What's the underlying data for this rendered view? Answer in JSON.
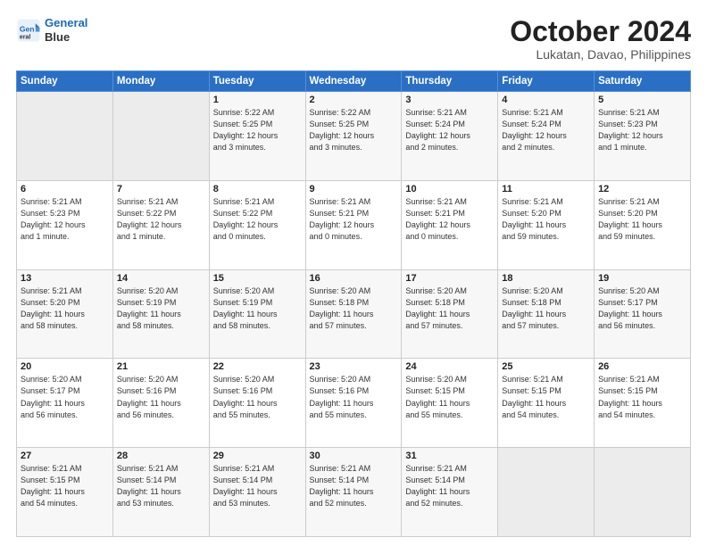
{
  "header": {
    "logo_line1": "General",
    "logo_line2": "Blue",
    "month_title": "October 2024",
    "location": "Lukatan, Davao, Philippines"
  },
  "weekdays": [
    "Sunday",
    "Monday",
    "Tuesday",
    "Wednesday",
    "Thursday",
    "Friday",
    "Saturday"
  ],
  "weeks": [
    [
      {
        "day": "",
        "info": ""
      },
      {
        "day": "",
        "info": ""
      },
      {
        "day": "1",
        "info": "Sunrise: 5:22 AM\nSunset: 5:25 PM\nDaylight: 12 hours\nand 3 minutes."
      },
      {
        "day": "2",
        "info": "Sunrise: 5:22 AM\nSunset: 5:25 PM\nDaylight: 12 hours\nand 3 minutes."
      },
      {
        "day": "3",
        "info": "Sunrise: 5:21 AM\nSunset: 5:24 PM\nDaylight: 12 hours\nand 2 minutes."
      },
      {
        "day": "4",
        "info": "Sunrise: 5:21 AM\nSunset: 5:24 PM\nDaylight: 12 hours\nand 2 minutes."
      },
      {
        "day": "5",
        "info": "Sunrise: 5:21 AM\nSunset: 5:23 PM\nDaylight: 12 hours\nand 1 minute."
      }
    ],
    [
      {
        "day": "6",
        "info": "Sunrise: 5:21 AM\nSunset: 5:23 PM\nDaylight: 12 hours\nand 1 minute."
      },
      {
        "day": "7",
        "info": "Sunrise: 5:21 AM\nSunset: 5:22 PM\nDaylight: 12 hours\nand 1 minute."
      },
      {
        "day": "8",
        "info": "Sunrise: 5:21 AM\nSunset: 5:22 PM\nDaylight: 12 hours\nand 0 minutes."
      },
      {
        "day": "9",
        "info": "Sunrise: 5:21 AM\nSunset: 5:21 PM\nDaylight: 12 hours\nand 0 minutes."
      },
      {
        "day": "10",
        "info": "Sunrise: 5:21 AM\nSunset: 5:21 PM\nDaylight: 12 hours\nand 0 minutes."
      },
      {
        "day": "11",
        "info": "Sunrise: 5:21 AM\nSunset: 5:20 PM\nDaylight: 11 hours\nand 59 minutes."
      },
      {
        "day": "12",
        "info": "Sunrise: 5:21 AM\nSunset: 5:20 PM\nDaylight: 11 hours\nand 59 minutes."
      }
    ],
    [
      {
        "day": "13",
        "info": "Sunrise: 5:21 AM\nSunset: 5:20 PM\nDaylight: 11 hours\nand 58 minutes."
      },
      {
        "day": "14",
        "info": "Sunrise: 5:20 AM\nSunset: 5:19 PM\nDaylight: 11 hours\nand 58 minutes."
      },
      {
        "day": "15",
        "info": "Sunrise: 5:20 AM\nSunset: 5:19 PM\nDaylight: 11 hours\nand 58 minutes."
      },
      {
        "day": "16",
        "info": "Sunrise: 5:20 AM\nSunset: 5:18 PM\nDaylight: 11 hours\nand 57 minutes."
      },
      {
        "day": "17",
        "info": "Sunrise: 5:20 AM\nSunset: 5:18 PM\nDaylight: 11 hours\nand 57 minutes."
      },
      {
        "day": "18",
        "info": "Sunrise: 5:20 AM\nSunset: 5:18 PM\nDaylight: 11 hours\nand 57 minutes."
      },
      {
        "day": "19",
        "info": "Sunrise: 5:20 AM\nSunset: 5:17 PM\nDaylight: 11 hours\nand 56 minutes."
      }
    ],
    [
      {
        "day": "20",
        "info": "Sunrise: 5:20 AM\nSunset: 5:17 PM\nDaylight: 11 hours\nand 56 minutes."
      },
      {
        "day": "21",
        "info": "Sunrise: 5:20 AM\nSunset: 5:16 PM\nDaylight: 11 hours\nand 56 minutes."
      },
      {
        "day": "22",
        "info": "Sunrise: 5:20 AM\nSunset: 5:16 PM\nDaylight: 11 hours\nand 55 minutes."
      },
      {
        "day": "23",
        "info": "Sunrise: 5:20 AM\nSunset: 5:16 PM\nDaylight: 11 hours\nand 55 minutes."
      },
      {
        "day": "24",
        "info": "Sunrise: 5:20 AM\nSunset: 5:15 PM\nDaylight: 11 hours\nand 55 minutes."
      },
      {
        "day": "25",
        "info": "Sunrise: 5:21 AM\nSunset: 5:15 PM\nDaylight: 11 hours\nand 54 minutes."
      },
      {
        "day": "26",
        "info": "Sunrise: 5:21 AM\nSunset: 5:15 PM\nDaylight: 11 hours\nand 54 minutes."
      }
    ],
    [
      {
        "day": "27",
        "info": "Sunrise: 5:21 AM\nSunset: 5:15 PM\nDaylight: 11 hours\nand 54 minutes."
      },
      {
        "day": "28",
        "info": "Sunrise: 5:21 AM\nSunset: 5:14 PM\nDaylight: 11 hours\nand 53 minutes."
      },
      {
        "day": "29",
        "info": "Sunrise: 5:21 AM\nSunset: 5:14 PM\nDaylight: 11 hours\nand 53 minutes."
      },
      {
        "day": "30",
        "info": "Sunrise: 5:21 AM\nSunset: 5:14 PM\nDaylight: 11 hours\nand 52 minutes."
      },
      {
        "day": "31",
        "info": "Sunrise: 5:21 AM\nSunset: 5:14 PM\nDaylight: 11 hours\nand 52 minutes."
      },
      {
        "day": "",
        "info": ""
      },
      {
        "day": "",
        "info": ""
      }
    ]
  ]
}
